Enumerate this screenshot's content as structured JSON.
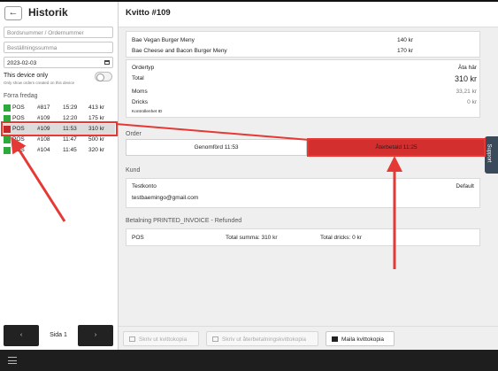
{
  "sidebar": {
    "back_glyph": "←",
    "title": "Historik",
    "search_table_placeholder": "Bordsnummer / Ordernummer",
    "search_sum_placeholder": "Beställningssumma",
    "date_value": "2023-02-03",
    "device_only_label": "This device only",
    "device_only_sub": "Only show orders created on this device",
    "section_label": "Förra fredag",
    "orders": [
      {
        "src": "POS",
        "num": "#817",
        "time": "15:29",
        "amount": "413 kr",
        "status": "done"
      },
      {
        "src": "POS",
        "num": "#109",
        "time": "12:20",
        "amount": "175 kr",
        "status": "done"
      },
      {
        "src": "POS",
        "num": "#109",
        "time": "11:53",
        "amount": "310 kr",
        "status": "refunded"
      },
      {
        "src": "POS",
        "num": "#108",
        "time": "11:47",
        "amount": "500 kr",
        "status": "done"
      },
      {
        "src": "POS",
        "num": "#104",
        "time": "11:45",
        "amount": "320 kr",
        "status": "done"
      }
    ],
    "pager": {
      "prev": "‹",
      "label": "Sida 1",
      "next": "›"
    }
  },
  "receipt": {
    "title": "Kvitto #109",
    "items": [
      {
        "name": "Bae Vegan Burger Meny",
        "price": "140 kr"
      },
      {
        "name": "Bae Cheese and Bacon Burger Meny",
        "price": "170 kr"
      }
    ],
    "totals": {
      "ordertyp_label": "Ordertyp",
      "ordertyp_value": "Äta här",
      "total_label": "Total",
      "total_value": "310 kr",
      "moms_label": "Moms",
      "moms_value": "33,21 kr",
      "dricks_label": "Dricks",
      "dricks_value": "0 kr",
      "kontroll_label": "Kontrollenhet ID"
    },
    "order_section": "Order",
    "status_done": "Genomförd 11:53",
    "status_refund": "Återbetald 11:25",
    "kund_section": "Kund",
    "customer_name": "Testkonto",
    "customer_type": "Default",
    "customer_email": "testbaemingo@gmail.com",
    "payment_section": "Betalning PRINTED_INVOICE - Refunded",
    "payment_method": "POS",
    "payment_total": "Total summa: 310 kr",
    "payment_tips": "Total dricks: 0 kr",
    "support": "Support",
    "footer": {
      "print_copy": "Skriv ut kvittokopia",
      "print_refund": "Skriv ut återbetalningskvittokopia",
      "mail_copy": "Maila kvittokopia"
    }
  },
  "colors": {
    "green": "#2eaa3c",
    "red": "#d32f2f",
    "annotation": "#e53935"
  }
}
